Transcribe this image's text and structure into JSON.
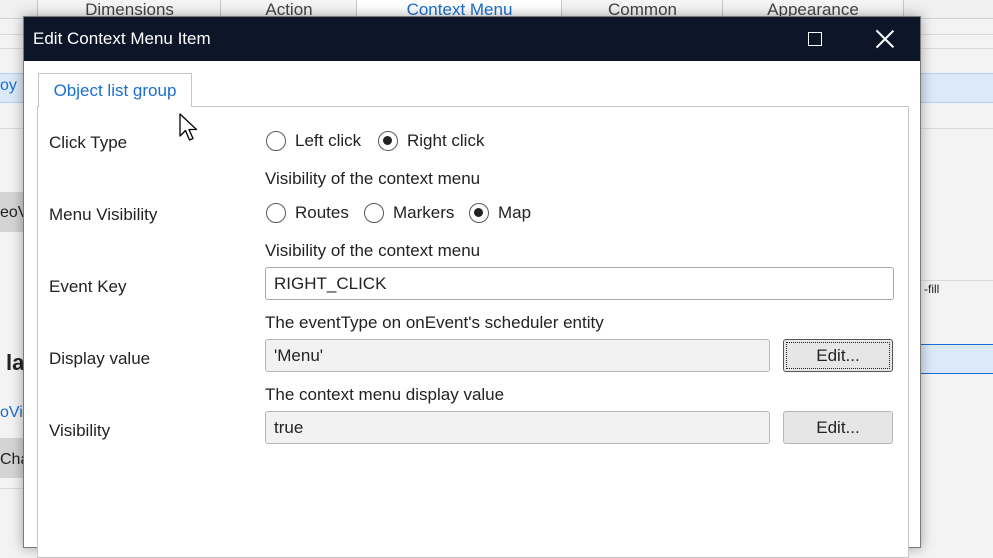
{
  "background": {
    "tabs": [
      "Dimensions",
      "Action",
      "Context Menu",
      "Common",
      "Appearance"
    ],
    "fragments": {
      "left_1": "oy",
      "left_2": "eoV",
      "left_3": "la",
      "left_4": "oVie",
      "left_5": "Cha",
      "right_1": "-fill"
    }
  },
  "dialog": {
    "title": "Edit Context Menu Item",
    "tab": "Object list group",
    "click_type": {
      "label": "Click Type",
      "options": [
        {
          "label": "Left click",
          "selected": false
        },
        {
          "label": "Right click",
          "selected": true
        }
      ],
      "hint": "Visibility of the context menu"
    },
    "menu_visibility": {
      "label": "Menu Visibility",
      "options": [
        {
          "label": "Routes",
          "selected": false
        },
        {
          "label": "Markers",
          "selected": false
        },
        {
          "label": "Map",
          "selected": true
        }
      ],
      "hint": "Visibility of the context menu"
    },
    "event_key": {
      "label": "Event Key",
      "value": "RIGHT_CLICK",
      "hint": "The eventType on onEvent's scheduler entity"
    },
    "display_value": {
      "label": "Display value",
      "value": "'Menu'",
      "button": "Edit...",
      "hint": "The context menu display value"
    },
    "visibility": {
      "label": "Visibility",
      "value": "true",
      "button": "Edit..."
    }
  }
}
